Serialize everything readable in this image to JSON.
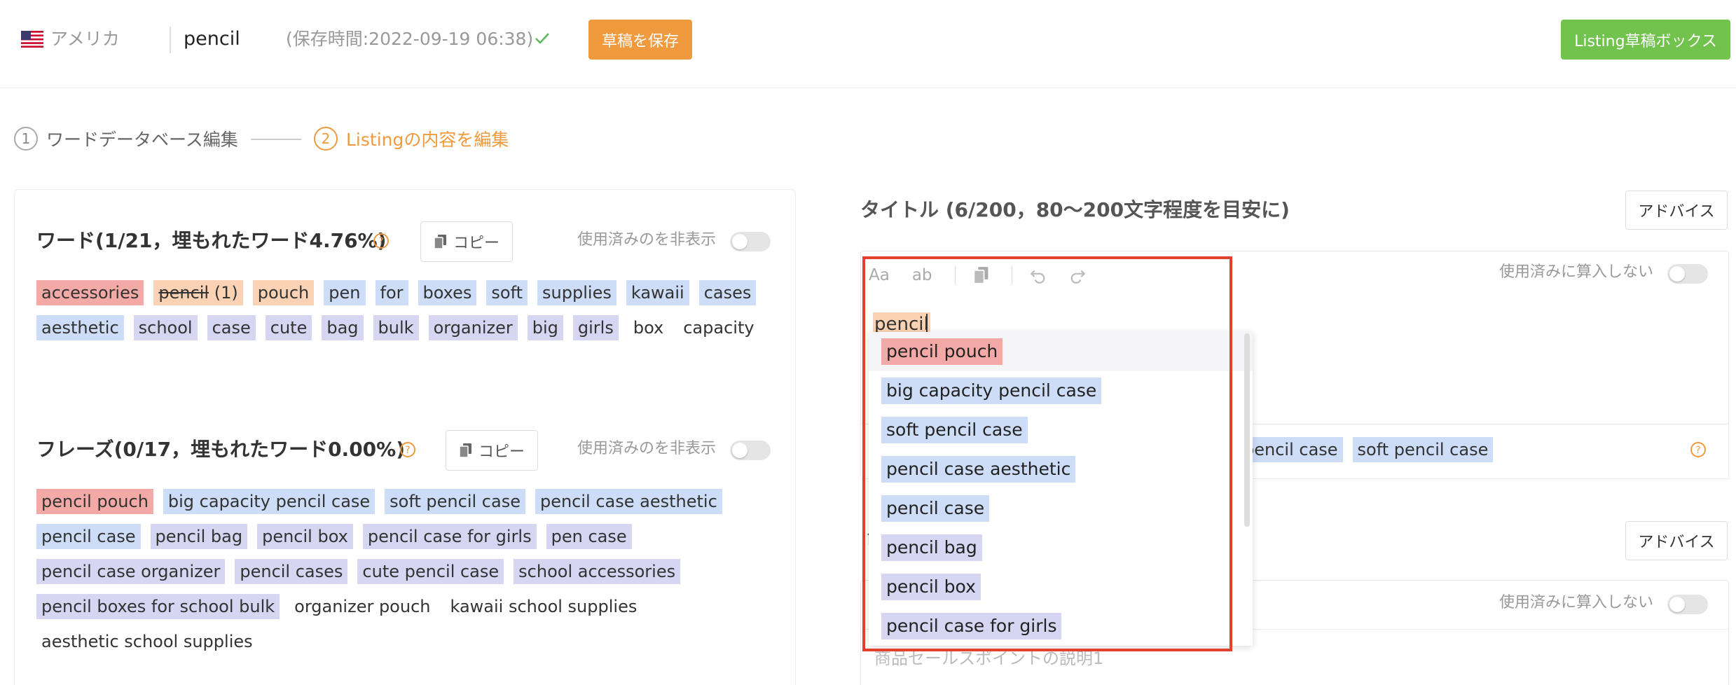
{
  "header": {
    "country": "アメリカ",
    "keyword": "pencil",
    "save_time": "(保存時間:2022-09-19 06:38)",
    "save_button": "草稿を保存",
    "draft_box_button": "Listing草稿ボックス"
  },
  "steps": [
    {
      "num": "1",
      "label": "ワードデータベース編集"
    },
    {
      "num": "2",
      "label": "Listingの内容を編集"
    }
  ],
  "words": {
    "title": "ワード(1/21，埋もれたワード4.76%)",
    "copy": "コピー",
    "hide_used": "使用済みのを非表示",
    "items": [
      {
        "text": "accessories",
        "style": "red"
      },
      {
        "text": "pencil",
        "count": " (1)",
        "style": "peach",
        "strike": true
      },
      {
        "text": "pouch",
        "style": "peach"
      },
      {
        "text": "pen",
        "style": "blue"
      },
      {
        "text": "for",
        "style": "blue"
      },
      {
        "text": "boxes",
        "style": "blue"
      },
      {
        "text": "soft",
        "style": "blue"
      },
      {
        "text": "supplies",
        "style": "blue"
      },
      {
        "text": "kawaii",
        "style": "blue"
      },
      {
        "text": "cases",
        "style": "blue"
      },
      {
        "text": "aesthetic",
        "style": "blue"
      },
      {
        "text": "school",
        "style": "lav"
      },
      {
        "text": "case",
        "style": "lav"
      },
      {
        "text": "cute",
        "style": "lav"
      },
      {
        "text": "bag",
        "style": "lav"
      },
      {
        "text": "bulk",
        "style": "lav"
      },
      {
        "text": "organizer",
        "style": "lav"
      },
      {
        "text": "big",
        "style": "lav"
      },
      {
        "text": "girls",
        "style": "lav"
      },
      {
        "text": "box",
        "style": "none"
      },
      {
        "text": "capacity",
        "style": "none"
      }
    ]
  },
  "phrases": {
    "title": "フレーズ(0/17，埋もれたワード0.00%)",
    "copy": "コピー",
    "hide_used": "使用済みのを非表示",
    "items": [
      {
        "text": "pencil pouch",
        "style": "red"
      },
      {
        "text": "big capacity pencil case",
        "style": "blue"
      },
      {
        "text": "soft pencil case",
        "style": "blue"
      },
      {
        "text": "pencil case aesthetic",
        "style": "blue"
      },
      {
        "text": "pencil case",
        "style": "blue"
      },
      {
        "text": "pencil bag",
        "style": "lav"
      },
      {
        "text": "pencil box",
        "style": "lav"
      },
      {
        "text": "pencil case for girls",
        "style": "lav"
      },
      {
        "text": "pen case",
        "style": "lav"
      },
      {
        "text": "pencil case organizer",
        "style": "lav"
      },
      {
        "text": "pencil cases",
        "style": "lav"
      },
      {
        "text": "cute pencil case",
        "style": "lav"
      },
      {
        "text": "school accessories",
        "style": "lav"
      },
      {
        "text": "pencil boxes for school bulk",
        "style": "lav"
      },
      {
        "text": "organizer pouch",
        "style": "none"
      },
      {
        "text": "kawaii school supplies",
        "style": "none"
      },
      {
        "text": "aesthetic school supplies",
        "style": "none"
      }
    ]
  },
  "title_editor": {
    "heading": "タイトル (6/200，80～200文字程度を目安に)",
    "advice": "アドバイス",
    "not_count": "使用済みに算入しない",
    "toolbar": {
      "aa": "Aa",
      "ab": "ab"
    },
    "typed_text": "pencil",
    "suggest_chips": [
      "pencil case",
      "soft pencil case"
    ]
  },
  "dropdown": {
    "items": [
      {
        "text": "pencil pouch",
        "style": "red"
      },
      {
        "text": "big capacity pencil case",
        "style": "blue"
      },
      {
        "text": "soft pencil case",
        "style": "blue"
      },
      {
        "text": "pencil case aesthetic",
        "style": "blue"
      },
      {
        "text": "pencil case",
        "style": "blue"
      },
      {
        "text": "pencil bag",
        "style": "lav"
      },
      {
        "text": "pencil box",
        "style": "lav"
      },
      {
        "text": "pencil case for girls",
        "style": "lav"
      }
    ]
  },
  "bullet_editor": {
    "side_glyph": "箇",
    "advice": "アドバイス",
    "not_count": "使用済みに算入しない",
    "placeholder": "商品セールスポイントの説明1"
  },
  "colors": {
    "orange": "#f09a3e",
    "green": "#72c24e",
    "red_chip": "#f3aaa6",
    "peach_chip": "#fbd3b4",
    "blue_chip": "#cddcf7",
    "lavender_chip": "#d6d5f2",
    "highlight": "#e2412b"
  }
}
